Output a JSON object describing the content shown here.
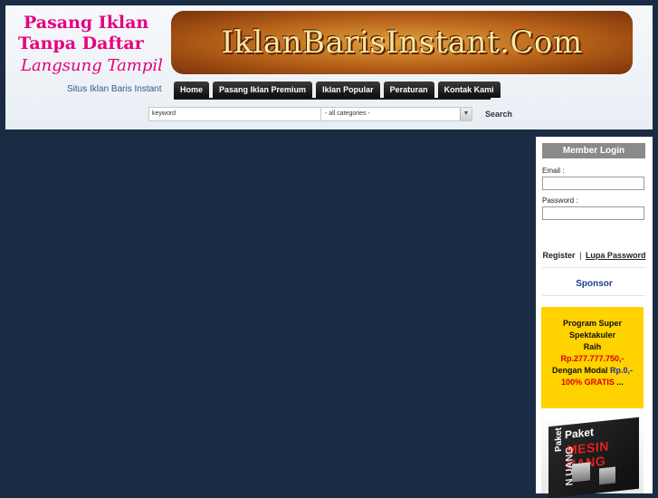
{
  "header": {
    "slogan_line1": "Pasang Iklan",
    "slogan_line2": "Tanpa Daftar",
    "slogan_line3": "Langsung Tampil",
    "tagline": "Situs Iklan Baris Instant",
    "banner_logo_text": "IklanBarisInstant.Com"
  },
  "nav": {
    "items": [
      {
        "label": "Home"
      },
      {
        "label": "Pasang Iklan Premium"
      },
      {
        "label": "Iklan Popular"
      },
      {
        "label": "Peraturan"
      },
      {
        "label": "Kontak Kami"
      }
    ]
  },
  "search": {
    "keyword_value": "keyword",
    "category_value": "- all categories -",
    "button_label": "Search"
  },
  "sidebar": {
    "login_title": "Member Login",
    "email_label": "Email :",
    "password_label": "Password :",
    "register_label": "Register",
    "separator": "|",
    "forgot_label": "Lupa Password",
    "sponsor_label": "Sponsor"
  },
  "ads": {
    "ad1": {
      "line1": "Program Super",
      "line2": "Spektakuler",
      "line3": "Raih",
      "line4": "Rp.277.777.750,-",
      "line5_prefix": "Dengan Modal",
      "line5_value": "Rp.0,-",
      "line6": "100% GRATIS",
      "line6_suffix": "..."
    },
    "ad2": {
      "paket_side": "Paket",
      "paket_top": "Paket",
      "title": "MESIN UANG",
      "side_text": "N UANG"
    }
  },
  "colors": {
    "page_bg": "#1a2b44",
    "slogan_pink": "#e6007e",
    "nav_bg": "#111111",
    "sponsor_blue": "#1c3f8c",
    "ad_yellow": "#ffd200",
    "price_red": "#d40000"
  }
}
